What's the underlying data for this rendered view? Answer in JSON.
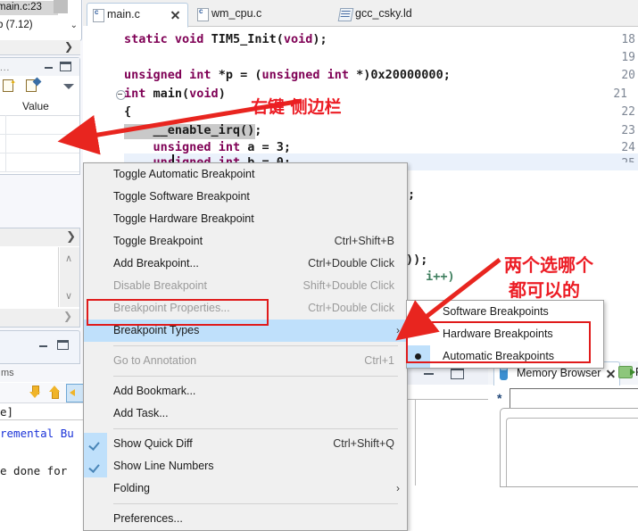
{
  "window": {
    "app": "Eclipse CDT IDE"
  },
  "left_panel": {
    "breakpoint_label": "main.c:23",
    "version_label": "b (7.12)",
    "expand_chevron": "❯",
    "dropdown_chevron": "⌄",
    "dots": "...",
    "value_header": "Value",
    "more_chevron": "❯",
    "view2_chevron": "❯",
    "scroll_up": "∧",
    "scroll_down": "∨",
    "console": {
      "title": "ms",
      "lines": [
        "e]",
        "remental Bu",
        "e done for"
      ]
    },
    "icons": {
      "minimize": "minimize-icon",
      "maximize": "maximize-icon",
      "new_view": "new-view-icon",
      "edit_view": "edit-view-icon",
      "view_menu": "view-menu-icon",
      "scroll_lock": "scroll-lock-icon"
    }
  },
  "editor": {
    "tabs": [
      {
        "label": "main.c",
        "icon": "c-file-icon",
        "active": true,
        "closable": true
      },
      {
        "label": "wm_cpu.c",
        "icon": "c-file-icon",
        "active": false,
        "closable": false
      },
      {
        "label": "gcc_csky.ld",
        "icon": "linker-script-icon",
        "active": false,
        "closable": false
      }
    ],
    "lines": [
      {
        "num": "18",
        "text": "static void TIM5_Init(void);"
      },
      {
        "num": "19",
        "text": ""
      },
      {
        "num": "20",
        "text": "unsigned int *p = (unsigned int *)0x20000000;"
      },
      {
        "num": "21",
        "text": "int main(void)",
        "fold": true
      },
      {
        "num": "22",
        "text": "{"
      },
      {
        "num": "23",
        "text": "    __enable_irq();",
        "highlight": true,
        "breakpoint": true
      },
      {
        "num": "24",
        "text": "    unsigned int a = 3;"
      },
      {
        "num": "25",
        "text": "    unsigned int b = 0;",
        "current": true
      }
    ],
    "right_fragments": [
      ";",
      "));",
      " i++)"
    ]
  },
  "context_menu": {
    "items": [
      {
        "label": "Toggle Automatic Breakpoint",
        "accel": "",
        "disabled": false,
        "type": "item"
      },
      {
        "label": "Toggle Software Breakpoint",
        "accel": "",
        "disabled": false,
        "type": "item"
      },
      {
        "label": "Toggle Hardware Breakpoint",
        "accel": "",
        "disabled": false,
        "type": "item"
      },
      {
        "label": "Toggle Breakpoint",
        "accel": "Ctrl+Shift+B",
        "disabled": false,
        "type": "item"
      },
      {
        "label": "Add Breakpoint...",
        "accel": "Ctrl+Double Click",
        "disabled": false,
        "type": "item"
      },
      {
        "label": "Disable Breakpoint",
        "accel": "Shift+Double Click",
        "disabled": true,
        "type": "item"
      },
      {
        "label": "Breakpoint Properties...",
        "accel": "Ctrl+Double Click",
        "disabled": true,
        "type": "item"
      },
      {
        "label": "Breakpoint Types",
        "accel": "",
        "disabled": false,
        "type": "submenu",
        "selected": true,
        "highlighted": true
      },
      {
        "label": "Go to Annotation",
        "accel": "Ctrl+1",
        "disabled": true,
        "type": "item",
        "separator_before": true
      },
      {
        "label": "Add Bookmark...",
        "accel": "",
        "disabled": false,
        "type": "item",
        "separator_before": true
      },
      {
        "label": "Add Task...",
        "accel": "",
        "disabled": false,
        "type": "item"
      },
      {
        "label": "Show Quick Diff",
        "accel": "Ctrl+Shift+Q",
        "disabled": false,
        "type": "check",
        "checked": true,
        "separator_before": true
      },
      {
        "label": "Show Line Numbers",
        "accel": "",
        "disabled": false,
        "type": "check",
        "checked": true
      },
      {
        "label": "Folding",
        "accel": "",
        "disabled": false,
        "type": "submenu"
      },
      {
        "label": "Preferences...",
        "accel": "",
        "disabled": false,
        "type": "item",
        "separator_before": true
      }
    ],
    "submenu_arrow": "›"
  },
  "submenu": {
    "items": [
      {
        "label": "Software Breakpoints",
        "selected": false
      },
      {
        "label": "Hardware Breakpoints",
        "selected": false
      },
      {
        "label": "Automatic Breakpoints",
        "selected": true
      }
    ]
  },
  "annotations": [
    {
      "id": "note-gutter",
      "text": "右键 侧边栏",
      "color": "#ec1c24"
    },
    {
      "id": "note-choice-1",
      "text": "两个选哪个",
      "color": "#ec1c24"
    },
    {
      "id": "note-choice-2",
      "text": "都可以的",
      "color": "#ec1c24"
    }
  ],
  "memory_browser": {
    "tab_label": "Memory Browser",
    "second_tab_label": "Pr",
    "address_prefix": "*",
    "address_value": "",
    "close_icon": "close-icon"
  },
  "colors": {
    "accent_blue": "#bfe0fb",
    "annotation_red": "#ec1c24",
    "keyword_purple": "#7f0055",
    "comment_green": "#3f7f5f",
    "ruler_blue": "#2a7fd4"
  }
}
